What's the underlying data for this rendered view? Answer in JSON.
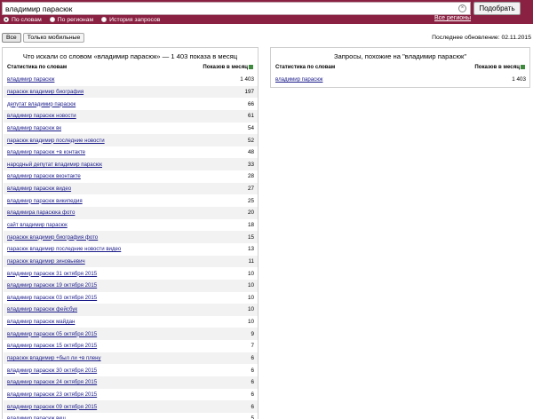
{
  "search": {
    "value": "владимир парасюк",
    "button": "Подобрать"
  },
  "modes": [
    {
      "label": "По словам",
      "selected": true
    },
    {
      "label": "По регионам",
      "selected": false
    },
    {
      "label": "История запросов",
      "selected": false
    }
  ],
  "regions_link": "Все регионы",
  "filters": [
    {
      "label": "Все",
      "active": true
    },
    {
      "label": "Только мобильные",
      "active": false
    }
  ],
  "updated": "Последнее обновление: 02.11.2015",
  "left_panel": {
    "title": "Что искали со словом «владимир парасюк» — 1 403 показа в месяц",
    "col_keyword": "Статистика по словам",
    "col_count": "Показов в месяц",
    "rows": [
      {
        "kw": "владимир парасюк",
        "n": "1 403"
      },
      {
        "kw": "парасюк владимир биография",
        "n": "197"
      },
      {
        "kw": "депутат владимир парасюк",
        "n": "66"
      },
      {
        "kw": "владимир парасюк новости",
        "n": "61"
      },
      {
        "kw": "владимир парасюк вк",
        "n": "54"
      },
      {
        "kw": "парасюк владимир последние новости",
        "n": "52"
      },
      {
        "kw": "владимир парасюк +в контакте",
        "n": "48"
      },
      {
        "kw": "народный депутат владимир парасюк",
        "n": "33"
      },
      {
        "kw": "владимир парасюк вконтакте",
        "n": "28"
      },
      {
        "kw": "владимир парасюк видео",
        "n": "27"
      },
      {
        "kw": "владимир парасюк википедия",
        "n": "25"
      },
      {
        "kw": "владимира парасюка фото",
        "n": "20"
      },
      {
        "kw": "сайт владимир парасюк",
        "n": "18"
      },
      {
        "kw": "парасюк владимир биография фото",
        "n": "15"
      },
      {
        "kw": "парасюк владимир последние новости видео",
        "n": "13"
      },
      {
        "kw": "парасюк владимир зиновьевич",
        "n": "11"
      },
      {
        "kw": "владимир парасюк 31 октября 2015",
        "n": "10"
      },
      {
        "kw": "владимир парасюк 19 октября 2015",
        "n": "10"
      },
      {
        "kw": "владимир парасюк 03 октября 2015",
        "n": "10"
      },
      {
        "kw": "владимир парасюк фейсбук",
        "n": "10"
      },
      {
        "kw": "владимир парасюк майдан",
        "n": "10"
      },
      {
        "kw": "владимир парасюк 05 октября 2015",
        "n": "9"
      },
      {
        "kw": "владимир парасюк 15 октября 2015",
        "n": "7"
      },
      {
        "kw": "парасюк владимир +был ли +в плену",
        "n": "6"
      },
      {
        "kw": "владимир парасюк 30 октября 2015",
        "n": "6"
      },
      {
        "kw": "владимир парасюк 24 октября 2015",
        "n": "6"
      },
      {
        "kw": "владимир парасюк 23 октября 2015",
        "n": "6"
      },
      {
        "kw": "владимир парасюк 09 октября 2015",
        "n": "6"
      },
      {
        "kw": "владимир парасюк вкщ",
        "n": "5"
      }
    ]
  },
  "right_panel": {
    "title": "Запросы, похожие на \"владимир парасюк\"",
    "col_keyword": "Статистика по словам",
    "col_count": "Показов в месяц",
    "rows": [
      {
        "kw": "владимир парасюк",
        "n": "1 403"
      }
    ]
  },
  "colors": {
    "header_bg": "#8a2142",
    "link": "#1a1a8a",
    "row_alt": "#f2f2f2"
  }
}
